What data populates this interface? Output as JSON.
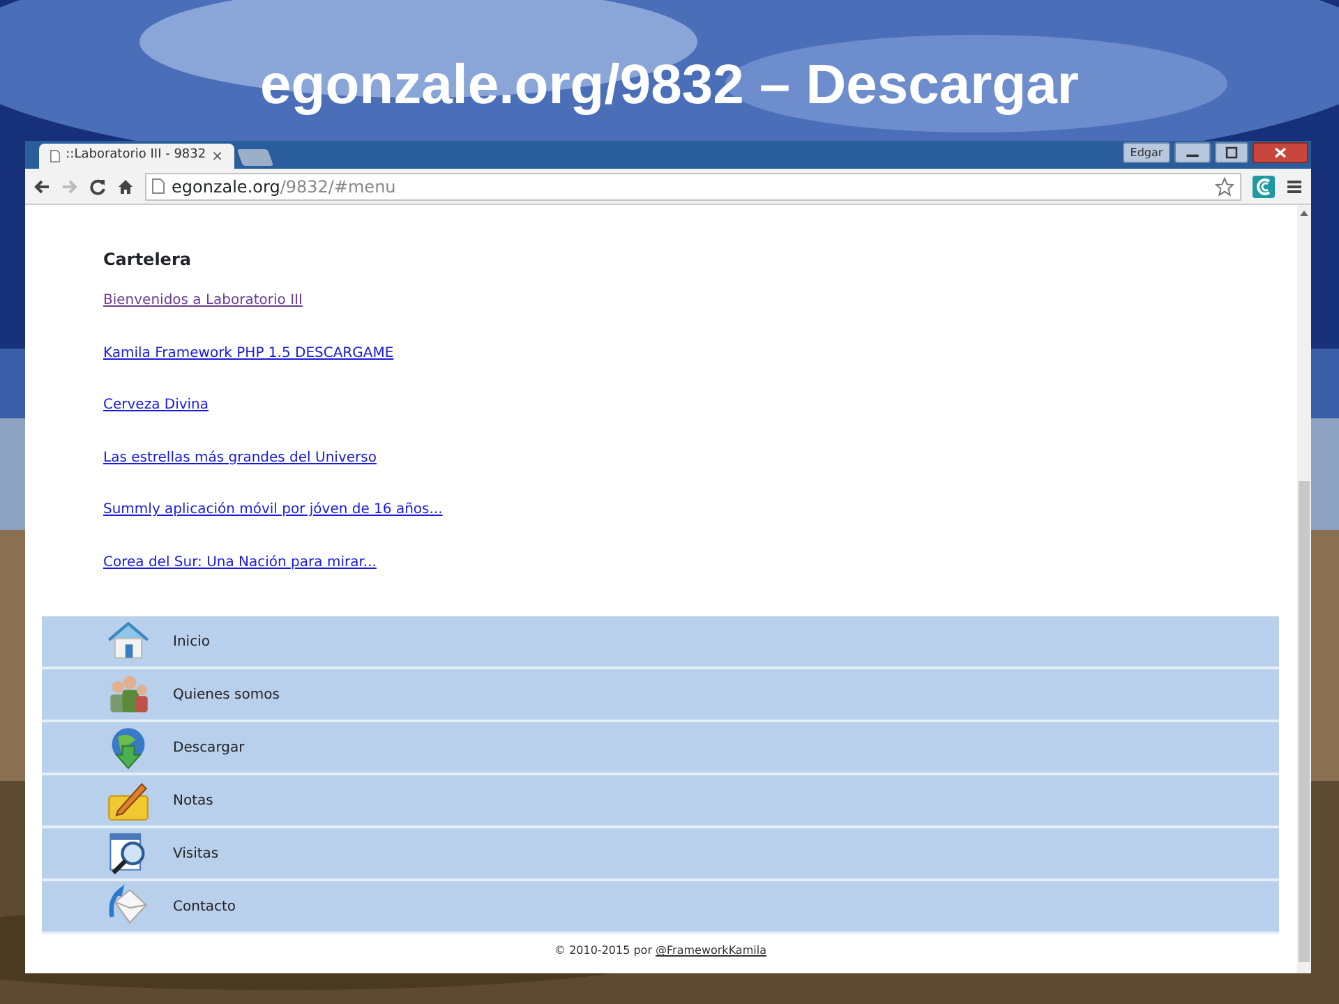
{
  "slide_title": "egonzale.org/9832 – Descargar",
  "browser": {
    "tab": {
      "title": "::Laboratorio III - 9832",
      "close": "×"
    },
    "profile": "Edgar",
    "url": {
      "host": "egonzale.org",
      "path": "/9832/#menu"
    }
  },
  "page": {
    "heading": "Cartelera",
    "links": [
      {
        "text": "Bienvenidos a Laboratorio III",
        "visited": true
      },
      {
        "text": "Kamila Framework PHP 1.5 DESCARGAME",
        "visited": false
      },
      {
        "text": "Cerveza Divina",
        "visited": false
      },
      {
        "text": "Las estrellas más grandes del Universo",
        "visited": false
      },
      {
        "text": "Summly aplicación móvil por jóven de 16 años...",
        "visited": false
      },
      {
        "text": "Corea del Sur: Una Nación para mirar...",
        "visited": false
      }
    ],
    "menu": [
      {
        "label": "Inicio"
      },
      {
        "label": "Quienes somos"
      },
      {
        "label": "Descargar"
      },
      {
        "label": "Notas"
      },
      {
        "label": "Visitas"
      },
      {
        "label": "Contacto"
      }
    ],
    "footer": {
      "text": "© 2010-2015 por",
      "link": "@FrameworkKamila"
    }
  }
}
